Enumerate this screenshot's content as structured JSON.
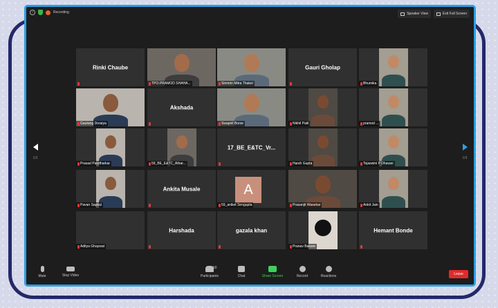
{
  "colors": {
    "page_bg": "#d6d9ea",
    "frame": "#24286a",
    "screen_border": "#2c9fe4",
    "leave": "#e22a2a",
    "share_screen": "#3fd05b",
    "active_speaker": "#d7e64a"
  },
  "topbar": {
    "recording_label": "Recording",
    "speaker_view_label": "Speaker View",
    "exit_full_screen_label": "Exit Full Screen",
    "icons": [
      "info-icon",
      "shield-icon",
      "record-dot-icon"
    ]
  },
  "nav": {
    "left_page": "1/3",
    "right_page": "1/3"
  },
  "tiles": [
    {
      "name": "Rinki Chaube",
      "label": "",
      "video": false
    },
    {
      "name": "",
      "label": "TPO-PRAMOD SHAHA...",
      "video": true
    },
    {
      "name": "",
      "label": "Sinmrin Mitra Thakel",
      "video": true,
      "active": true
    },
    {
      "name": "Gauri Gholap",
      "label": "",
      "video": false
    },
    {
      "name": "",
      "label": "Bhumika",
      "video": true
    },
    {
      "name": "",
      "label": "Gautang Doraiya",
      "video": true
    },
    {
      "name": "Akshada",
      "label": "",
      "video": false
    },
    {
      "name": "",
      "label": "Swapnil Borse",
      "video": true
    },
    {
      "name": "",
      "label": "Nikhil Patil",
      "video": true
    },
    {
      "name": "",
      "label": "pramod ...",
      "video": true
    },
    {
      "name": "",
      "label": "Prasad Pandharkar",
      "video": true
    },
    {
      "name": "",
      "label": "59_BE_E&TC_Athar...",
      "video": true
    },
    {
      "name": "17_BE_E&TC_Vr...",
      "label": "",
      "video": false
    },
    {
      "name": "",
      "label": "Harsh Gupta",
      "video": true
    },
    {
      "name": "",
      "label": "Tejaswini P Dhavan",
      "video": true
    },
    {
      "name": "",
      "label": "Pavan Sapkal",
      "video": true
    },
    {
      "name": "Ankita Musale",
      "label": "",
      "video": false
    },
    {
      "name": "",
      "label": "59_aniket Sengupta",
      "video": true,
      "avatar_letter": "A"
    },
    {
      "name": "",
      "label": "Prasanjit Wasekar",
      "video": true
    },
    {
      "name": "",
      "label": "Ankit Jain",
      "video": true
    },
    {
      "name": "",
      "label": "Aditya Ghaywat",
      "video": false
    },
    {
      "name": "Harshada",
      "label": "",
      "video": false
    },
    {
      "name": "gazala khan",
      "label": "",
      "video": false
    },
    {
      "name": "",
      "label": "Pranav Bakare",
      "video": true
    },
    {
      "name": "Hemant Bonde",
      "label": "",
      "video": false
    }
  ],
  "bottombar": {
    "mute_label": "Mute",
    "stop_video_label": "Stop Video",
    "participants_label": "Participants",
    "participants_count": "60",
    "chat_label": "Chat",
    "share_screen_label": "Share Screen",
    "record_label": "Record",
    "reactions_label": "Reactions",
    "leave_label": "Leave"
  }
}
